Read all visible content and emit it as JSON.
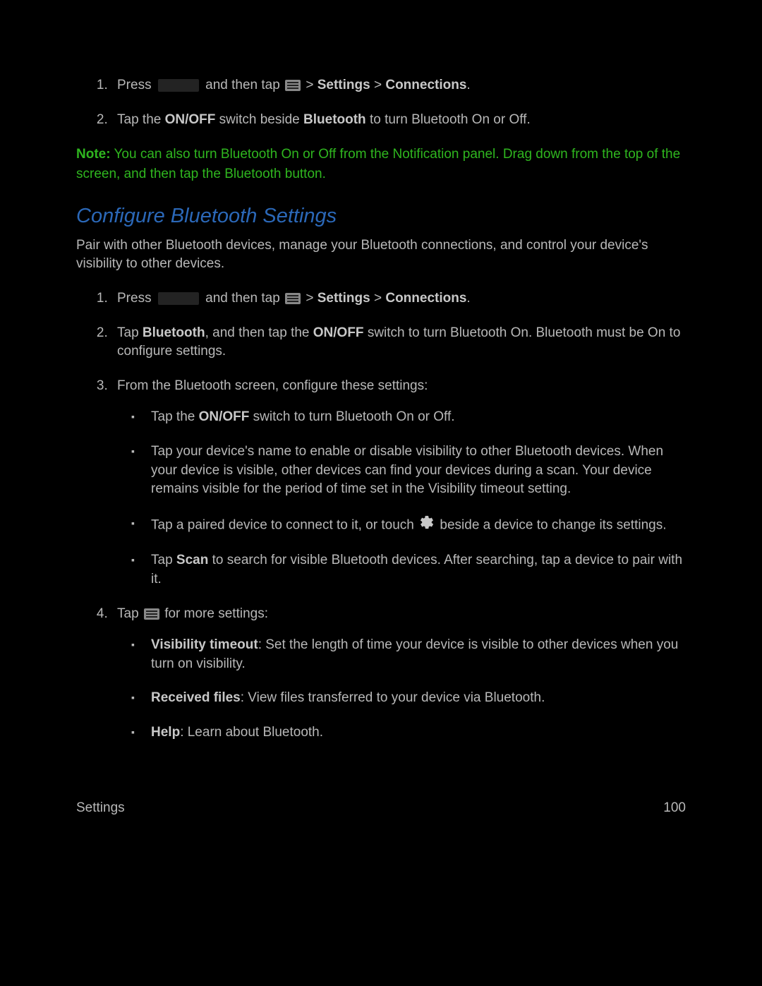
{
  "topList": {
    "item1": {
      "press": "Press ",
      "andTap": " and then tap ",
      "gt": " > ",
      "settings": "Settings",
      "connections": "Connections",
      "period": "."
    },
    "item2": {
      "pre": "Tap the ",
      "onoff": "ON/OFF",
      "mid": " switch beside ",
      "bluetooth": "Bluetooth",
      "post": " to turn Bluetooth On or Off."
    }
  },
  "note": {
    "label": "Note:",
    "text": " You can also turn Bluetooth On or Off from the Notification panel. Drag down from the top of the screen, and then tap the Bluetooth button."
  },
  "heading": "Configure Bluetooth Settings",
  "intro": "Pair with other Bluetooth devices, manage your Bluetooth connections, and control your device's visibility to other devices.",
  "mainList": {
    "item1": {
      "press": "Press ",
      "andTap": " and then tap ",
      "gt": " > ",
      "settings": "Settings",
      "connections": "Connections",
      "period": "."
    },
    "item2": {
      "pre": "Tap ",
      "bluetooth": "Bluetooth",
      "mid": ", and then tap the ",
      "onoff": "ON/OFF",
      "post": " switch to turn Bluetooth On. Bluetooth must be On to configure settings."
    },
    "item3": {
      "text": "From the Bluetooth screen, configure these settings:",
      "sub1": {
        "pre": "Tap the ",
        "onoff": "ON/OFF",
        "post": " switch to turn Bluetooth On or Off."
      },
      "sub2": "Tap your device's name to enable or disable visibility to other Bluetooth devices. When your device is visible, other devices can find your devices during a scan. Your device remains visible for the period of time set in the Visibility timeout setting.",
      "sub3": {
        "pre": "Tap a paired device to connect to it, or touch ",
        "post": " beside a device to change its settings."
      },
      "sub4": {
        "pre": "Tap ",
        "scan": "Scan",
        "post": " to search for visible Bluetooth devices. After searching, tap a device to pair with it."
      }
    },
    "item4": {
      "pre": "Tap ",
      "post": " for more settings:",
      "sub1": {
        "label": "Visibility timeout",
        "text": ": Set the length of time your device is visible to other devices when you turn on visibility."
      },
      "sub2": {
        "label": "Received files",
        "text": ": View files transferred to your device via Bluetooth."
      },
      "sub3": {
        "label": "Help",
        "text": ": Learn about Bluetooth."
      }
    }
  },
  "footer": {
    "section": "Settings",
    "page": "100"
  }
}
